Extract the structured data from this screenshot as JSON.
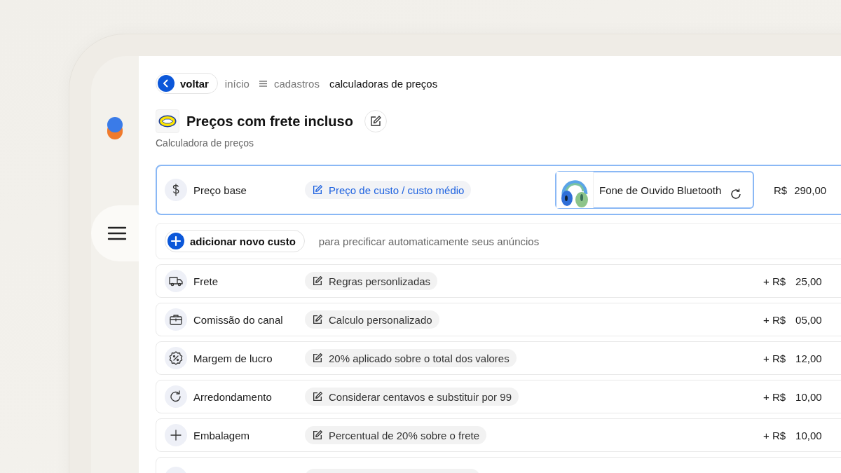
{
  "breadcrumb": {
    "back": "voltar",
    "items": [
      "início",
      "cadastros",
      "calculadoras de preços"
    ]
  },
  "header": {
    "title": "Preços com frete incluso",
    "subtitle": "Calculadora de preços"
  },
  "base_row": {
    "label": "Preço base",
    "chip": "Preço de custo / custo médio",
    "product": "Fone de Ouvido Bluetooth",
    "currency": "R$",
    "amount": "290,00"
  },
  "add_cost": {
    "button": "adicionar novo custo",
    "hint": "para precificar automaticamente seus anúncios"
  },
  "costs": [
    {
      "kind": "truck",
      "label": "Frete",
      "chip": "Regras personlizadas",
      "prefix": "+ R$",
      "amount": "25,00"
    },
    {
      "kind": "briefcase",
      "label": "Comissão do canal",
      "chip": "Calculo personalizado",
      "prefix": "+ R$",
      "amount": "05,00"
    },
    {
      "kind": "percent",
      "label": "Margem de lucro",
      "chip": "20% aplicado sobre o total dos valores",
      "prefix": "+ R$",
      "amount": "12,00"
    },
    {
      "kind": "refresh",
      "label": "Arredondamento",
      "chip": "Considerar centavos e substituir por 99",
      "prefix": "+ R$",
      "amount": "10,00"
    },
    {
      "kind": "plus",
      "label": "Embalagem",
      "chip": "Percentual de 20% sobre o frete",
      "prefix": "+ R$",
      "amount": "10,00"
    }
  ]
}
